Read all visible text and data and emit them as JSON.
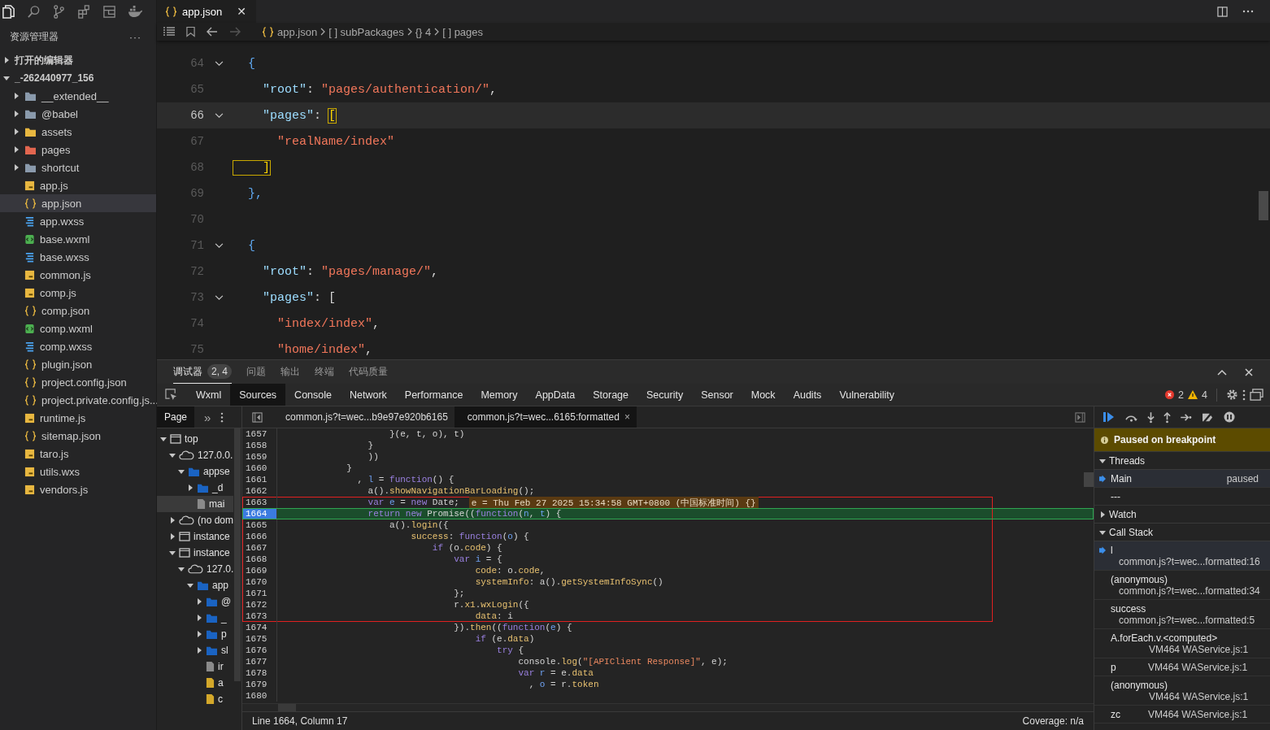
{
  "activity_bar": {
    "panel_title": "资源管理器",
    "more": "···"
  },
  "explorer": {
    "items": [
      {
        "label": "打开的编辑器",
        "kind": "section",
        "expanded": false,
        "selected": false
      },
      {
        "label": "_-262440977_156",
        "kind": "section",
        "expanded": true,
        "selected": false,
        "children": [
          {
            "label": "__extended__",
            "kind": "folder",
            "color": "#8a9aac",
            "expanded": false,
            "selected": false
          },
          {
            "label": "@babel",
            "kind": "folder",
            "color": "#8a9aac",
            "expanded": false,
            "selected": false
          },
          {
            "label": "assets",
            "kind": "folder",
            "color": "#e8b740",
            "expanded": false,
            "selected": false
          },
          {
            "label": "pages",
            "kind": "folder",
            "color": "#e2664f",
            "expanded": false,
            "selected": false
          },
          {
            "label": "shortcut",
            "kind": "folder",
            "color": "#8a9aac",
            "expanded": false,
            "selected": false
          },
          {
            "label": "app.js",
            "kind": "js",
            "selected": false
          },
          {
            "label": "app.json",
            "kind": "json",
            "selected": true
          },
          {
            "label": "app.wxss",
            "kind": "wxss",
            "selected": false
          },
          {
            "label": "base.wxml",
            "kind": "wxml",
            "selected": false
          },
          {
            "label": "base.wxss",
            "kind": "wxss",
            "selected": false
          },
          {
            "label": "common.js",
            "kind": "js",
            "selected": false
          },
          {
            "label": "comp.js",
            "kind": "js",
            "selected": false
          },
          {
            "label": "comp.json",
            "kind": "json",
            "selected": false
          },
          {
            "label": "comp.wxml",
            "kind": "wxml",
            "selected": false
          },
          {
            "label": "comp.wxss",
            "kind": "wxss",
            "selected": false
          },
          {
            "label": "plugin.json",
            "kind": "json",
            "selected": false
          },
          {
            "label": "project.config.json",
            "kind": "json",
            "selected": false
          },
          {
            "label": "project.private.config.js...",
            "kind": "json",
            "selected": false
          },
          {
            "label": "runtime.js",
            "kind": "js",
            "selected": false
          },
          {
            "label": "sitemap.json",
            "kind": "json",
            "selected": false
          },
          {
            "label": "taro.js",
            "kind": "js",
            "selected": false
          },
          {
            "label": "utils.wxs",
            "kind": "js",
            "selected": false
          },
          {
            "label": "vendors.js",
            "kind": "js",
            "selected": false
          }
        ]
      }
    ]
  },
  "editor": {
    "tab": {
      "label": "app.json",
      "close": "✕"
    },
    "breadcrumb": [
      {
        "label": "app.json",
        "kind": "json"
      },
      {
        "label": "[ ] subPackages",
        "kind": "plain"
      },
      {
        "label": "{} 4",
        "kind": "plain"
      },
      {
        "label": "[ ] pages",
        "kind": "plain"
      }
    ],
    "lines": [
      {
        "number": "64",
        "fold": true,
        "current": false,
        "tokens": [
          {
            "text": "  {",
            "kind": "brace"
          }
        ]
      },
      {
        "number": "65",
        "fold": false,
        "current": false,
        "tokens": [
          {
            "text": "    \"root\"",
            "kind": "key"
          },
          {
            "text": ": ",
            "kind": "punct"
          },
          {
            "text": "\"pages/authentication/\"",
            "kind": "str"
          },
          {
            "text": ",",
            "kind": "punct"
          }
        ]
      },
      {
        "number": "66",
        "fold": true,
        "current": true,
        "tokens": [
          {
            "text": "    \"pages\"",
            "kind": "key"
          },
          {
            "text": ": ",
            "kind": "punct"
          },
          {
            "text": "[",
            "kind": "match"
          }
        ]
      },
      {
        "number": "67",
        "fold": false,
        "current": false,
        "tokens": [
          {
            "text": "      \"realName/index\"",
            "kind": "str"
          }
        ]
      },
      {
        "number": "68",
        "fold": false,
        "current": false,
        "tokens": [
          {
            "text": "    ]",
            "kind": "match"
          }
        ]
      },
      {
        "number": "69",
        "fold": false,
        "current": false,
        "tokens": [
          {
            "text": "  },",
            "kind": "brace"
          }
        ]
      },
      {
        "number": "70",
        "fold": false,
        "current": false
      },
      {
        "number": "71",
        "fold": true,
        "current": false,
        "tokens": [
          {
            "text": "  {",
            "kind": "brace"
          }
        ]
      },
      {
        "number": "72",
        "fold": false,
        "current": false,
        "tokens": [
          {
            "text": "    \"root\"",
            "kind": "key"
          },
          {
            "text": ": ",
            "kind": "punct"
          },
          {
            "text": "\"pages/manage/\"",
            "kind": "str"
          },
          {
            "text": ",",
            "kind": "punct"
          }
        ]
      },
      {
        "number": "73",
        "fold": true,
        "current": false,
        "tokens": [
          {
            "text": "    \"pages\"",
            "kind": "key"
          },
          {
            "text": ": [",
            "kind": "punct"
          }
        ]
      },
      {
        "number": "74",
        "fold": false,
        "current": false,
        "tokens": [
          {
            "text": "      \"index/index\"",
            "kind": "str"
          },
          {
            "text": ",",
            "kind": "punct"
          }
        ]
      },
      {
        "number": "75",
        "fold": false,
        "current": false,
        "tokens": [
          {
            "text": "      \"home/index\"",
            "kind": "str"
          },
          {
            "text": ",",
            "kind": "punct"
          }
        ]
      }
    ]
  },
  "devtools": {
    "panel_tabs": [
      {
        "label": "调试器",
        "badge": "2, 4",
        "selected": true
      },
      {
        "label": "问题",
        "selected": false
      },
      {
        "label": "输出",
        "selected": false
      },
      {
        "label": "终端",
        "selected": false
      },
      {
        "label": "代码质量",
        "selected": false
      }
    ],
    "tool_tabs": [
      {
        "label": "Wxml",
        "selected": false
      },
      {
        "label": "Sources",
        "selected": true
      },
      {
        "label": "Console",
        "selected": false
      },
      {
        "label": "Network",
        "selected": false
      },
      {
        "label": "Performance",
        "selected": false
      },
      {
        "label": "Memory",
        "selected": false
      },
      {
        "label": "AppData",
        "selected": false
      },
      {
        "label": "Storage",
        "selected": false
      },
      {
        "label": "Security",
        "selected": false
      },
      {
        "label": "Sensor",
        "selected": false
      },
      {
        "label": "Mock",
        "selected": false
      },
      {
        "label": "Audits",
        "selected": false
      },
      {
        "label": "Vulnerability",
        "selected": false
      }
    ],
    "errors": "2",
    "warnings": "4",
    "navigator": {
      "tab": "Page",
      "more": "»",
      "tree": [
        {
          "label": "top",
          "kind": "frame",
          "expanded": true,
          "selected": false,
          "children": [
            {
              "label": "127.0.0.",
              "kind": "cloud",
              "expanded": true,
              "selected": false,
              "children": [
                {
                  "label": "appse",
                  "kind": "folder",
                  "expanded": true,
                  "selected": false,
                  "children": [
                    {
                      "label": "_d",
                      "kind": "folder",
                      "expanded": false,
                      "selected": false
                    },
                    {
                      "label": "mai",
                      "kind": "file",
                      "selected": true
                    }
                  ]
                }
              ]
            },
            {
              "label": "(no dom",
              "kind": "cloud",
              "expanded": false,
              "selected": false
            },
            {
              "label": "instance",
              "kind": "frame",
              "expanded": false,
              "selected": false
            },
            {
              "label": "instance",
              "kind": "frame",
              "expanded": true,
              "selected": false,
              "children": [
                {
                  "label": "127.0.",
                  "kind": "cloud",
                  "expanded": true,
                  "selected": false,
                  "children": [
                    {
                      "label": "app",
                      "kind": "folder",
                      "expanded": true,
                      "selected": false,
                      "children": [
                        {
                          "label": "@",
                          "kind": "folder",
                          "expanded": false,
                          "selected": false
                        },
                        {
                          "label": "_",
                          "kind": "folder",
                          "expanded": false,
                          "selected": false
                        },
                        {
                          "label": "p",
                          "kind": "folder",
                          "expanded": false,
                          "selected": false
                        },
                        {
                          "label": "sl",
                          "kind": "folder",
                          "expanded": false,
                          "selected": false
                        },
                        {
                          "label": "ir",
                          "kind": "file",
                          "selected": false
                        },
                        {
                          "label": "a",
                          "kind": "jsfile",
                          "selected": false
                        },
                        {
                          "label": "c",
                          "kind": "jsfile",
                          "selected": false
                        }
                      ]
                    }
                  ]
                }
              ]
            }
          ]
        }
      ]
    },
    "file_tabs": [
      {
        "label": "common.js?t=wec...b9e97e920b6165",
        "selected": false
      },
      {
        "label": "common.js?t=wec...6165:formatted",
        "selected": true,
        "close": "×"
      }
    ],
    "code": [
      {
        "number": "1657",
        "current": false,
        "boxed": false,
        "tokens": [
          {
            "text": "                    }(e, t, o), t)",
            "kind": "plain"
          }
        ]
      },
      {
        "number": "1658",
        "current": false,
        "boxed": false,
        "tokens": [
          {
            "text": "                }",
            "kind": "plain"
          }
        ]
      },
      {
        "number": "1659",
        "current": false,
        "boxed": false,
        "tokens": [
          {
            "text": "                ))",
            "kind": "plain"
          }
        ]
      },
      {
        "number": "1660",
        "current": false,
        "boxed": false,
        "tokens": [
          {
            "text": "            }",
            "kind": "plain"
          }
        ]
      },
      {
        "number": "1661",
        "current": false,
        "boxed": false,
        "tokens": [
          {
            "text": "              , ",
            "kind": "plain"
          },
          {
            "text": "l",
            "kind": "var"
          },
          {
            "text": " = ",
            "kind": "plain"
          },
          {
            "text": "function",
            "kind": "kw"
          },
          {
            "text": "() {",
            "kind": "plain"
          }
        ]
      },
      {
        "number": "1662",
        "current": false,
        "boxed": false,
        "tokens": [
          {
            "text": "                a().",
            "kind": "plain"
          },
          {
            "text": "showNavigationBarLoading",
            "kind": "prop"
          },
          {
            "text": "();",
            "kind": "plain"
          }
        ]
      },
      {
        "number": "1663",
        "current": false,
        "boxed": true,
        "inline_value": "e = Thu Feb 27 2025 15:34:58 GMT+0800 (中国标准时间) {}",
        "tokens": [
          {
            "text": "                var",
            "kind": "kw"
          },
          {
            "text": " e",
            "kind": "var"
          },
          {
            "text": " = ",
            "kind": "plain"
          },
          {
            "text": "new",
            "kind": "kw"
          },
          {
            "text": " Date;",
            "kind": "plain"
          }
        ]
      },
      {
        "number": "1664",
        "current": true,
        "boxed": true,
        "tokens": [
          {
            "text": "                return",
            "kind": "kw"
          },
          {
            "text": " new",
            "kind": "kw"
          },
          {
            "text": " Promise((",
            "kind": "plain"
          },
          {
            "text": "function",
            "kind": "kw"
          },
          {
            "text": "(",
            "kind": "plain"
          },
          {
            "text": "n",
            "kind": "var"
          },
          {
            "text": ", ",
            "kind": "plain"
          },
          {
            "text": "t",
            "kind": "var"
          },
          {
            "text": ") {",
            "kind": "plain"
          }
        ]
      },
      {
        "number": "1665",
        "current": false,
        "boxed": true,
        "tokens": [
          {
            "text": "                    a().",
            "kind": "plain"
          },
          {
            "text": "login",
            "kind": "prop"
          },
          {
            "text": "({",
            "kind": "plain"
          }
        ]
      },
      {
        "number": "1666",
        "current": false,
        "boxed": true,
        "tokens": [
          {
            "text": "                        success",
            "kind": "prop"
          },
          {
            "text": ": ",
            "kind": "plain"
          },
          {
            "text": "function",
            "kind": "kw"
          },
          {
            "text": "(",
            "kind": "plain"
          },
          {
            "text": "o",
            "kind": "var"
          },
          {
            "text": ") {",
            "kind": "plain"
          }
        ]
      },
      {
        "number": "1667",
        "current": false,
        "boxed": true,
        "tokens": [
          {
            "text": "                            if",
            "kind": "kw"
          },
          {
            "text": " (o.",
            "kind": "plain"
          },
          {
            "text": "code",
            "kind": "prop"
          },
          {
            "text": ") {",
            "kind": "plain"
          }
        ]
      },
      {
        "number": "1668",
        "current": false,
        "boxed": true,
        "tokens": [
          {
            "text": "                                var",
            "kind": "kw"
          },
          {
            "text": " i",
            "kind": "var"
          },
          {
            "text": " = {",
            "kind": "plain"
          }
        ]
      },
      {
        "number": "1669",
        "current": false,
        "boxed": true,
        "tokens": [
          {
            "text": "                                    code",
            "kind": "prop"
          },
          {
            "text": ": o.",
            "kind": "plain"
          },
          {
            "text": "code",
            "kind": "prop"
          },
          {
            "text": ",",
            "kind": "plain"
          }
        ]
      },
      {
        "number": "1670",
        "current": false,
        "boxed": true,
        "tokens": [
          {
            "text": "                                    systemInfo",
            "kind": "prop"
          },
          {
            "text": ": a().",
            "kind": "plain"
          },
          {
            "text": "getSystemInfoSync",
            "kind": "prop"
          },
          {
            "text": "()",
            "kind": "plain"
          }
        ]
      },
      {
        "number": "1671",
        "current": false,
        "boxed": true,
        "tokens": [
          {
            "text": "                                };",
            "kind": "plain"
          }
        ]
      },
      {
        "number": "1672",
        "current": false,
        "boxed": true,
        "tokens": [
          {
            "text": "                                r.",
            "kind": "plain"
          },
          {
            "text": "x1",
            "kind": "prop"
          },
          {
            "text": ".",
            "kind": "plain"
          },
          {
            "text": "wxLogin",
            "kind": "prop"
          },
          {
            "text": "({",
            "kind": "plain"
          }
        ]
      },
      {
        "number": "1673",
        "current": false,
        "boxed": true,
        "tokens": [
          {
            "text": "                                    data",
            "kind": "prop"
          },
          {
            "text": ": i",
            "kind": "plain"
          }
        ]
      },
      {
        "number": "1674",
        "current": false,
        "boxed": false,
        "tokens": [
          {
            "text": "                                }).",
            "kind": "plain"
          },
          {
            "text": "then",
            "kind": "prop"
          },
          {
            "text": "((",
            "kind": "plain"
          },
          {
            "text": "function",
            "kind": "kw"
          },
          {
            "text": "(",
            "kind": "plain"
          },
          {
            "text": "e",
            "kind": "var"
          },
          {
            "text": ") {",
            "kind": "plain"
          }
        ]
      },
      {
        "number": "1675",
        "current": false,
        "boxed": false,
        "tokens": [
          {
            "text": "                                    if",
            "kind": "kw"
          },
          {
            "text": " (e.",
            "kind": "plain"
          },
          {
            "text": "data",
            "kind": "prop"
          },
          {
            "text": ")",
            "kind": "plain"
          }
        ]
      },
      {
        "number": "1676",
        "current": false,
        "boxed": false,
        "tokens": [
          {
            "text": "                                        try",
            "kind": "kw"
          },
          {
            "text": " {",
            "kind": "plain"
          }
        ]
      },
      {
        "number": "1677",
        "current": false,
        "boxed": false,
        "tokens": [
          {
            "text": "                                            console.",
            "kind": "plain"
          },
          {
            "text": "log",
            "kind": "prop"
          },
          {
            "text": "(",
            "kind": "plain"
          },
          {
            "text": "\"[APIClient Response]\"",
            "kind": "str"
          },
          {
            "text": ", e);",
            "kind": "plain"
          }
        ]
      },
      {
        "number": "1678",
        "current": false,
        "boxed": false,
        "tokens": [
          {
            "text": "                                            var",
            "kind": "kw"
          },
          {
            "text": " r",
            "kind": "var"
          },
          {
            "text": " = e.",
            "kind": "plain"
          },
          {
            "text": "data",
            "kind": "prop"
          }
        ]
      },
      {
        "number": "1679",
        "current": false,
        "boxed": false,
        "tokens": [
          {
            "text": "                                              , ",
            "kind": "plain"
          },
          {
            "text": "o",
            "kind": "var"
          },
          {
            "text": " = r.",
            "kind": "plain"
          },
          {
            "text": "token",
            "kind": "prop"
          }
        ]
      },
      {
        "number": "1680",
        "current": false,
        "boxed": false
      }
    ],
    "status": {
      "position": "Line 1664, Column 17",
      "coverage": "Coverage: n/a"
    },
    "debugger": {
      "banner": "Paused on breakpoint",
      "threads": {
        "title": "Threads",
        "expanded": true,
        "items": [
          {
            "name": "Main",
            "state": "paused",
            "selected": true
          },
          {
            "name": "---",
            "selected": false
          }
        ]
      },
      "watch": {
        "title": "Watch",
        "expanded": false
      },
      "call_stack": {
        "title": "Call Stack",
        "expanded": true,
        "frames": [
          {
            "name": "l",
            "location": "common.js?t=wec...formatted:16",
            "kind": "stacked",
            "selected": true
          },
          {
            "name": "(anonymous)",
            "location": "common.js?t=wec...formatted:34",
            "kind": "stacked",
            "selected": false
          },
          {
            "name": "success",
            "location": "common.js?t=wec...formatted:5",
            "kind": "stacked",
            "selected": false
          },
          {
            "name": "A.forEach.v.<computed>",
            "location": "VM464 WAService.js:1",
            "kind": "stacked-right",
            "selected": false
          },
          {
            "name": "p",
            "location": "VM464 WAService.js:1",
            "kind": "inline",
            "selected": false
          },
          {
            "name": "(anonymous)",
            "location": "VM464 WAService.js:1",
            "kind": "stacked-right",
            "selected": false
          },
          {
            "name": "zc",
            "location": "VM464 WAService.js:1",
            "kind": "inline",
            "selected": false
          }
        ]
      }
    }
  }
}
